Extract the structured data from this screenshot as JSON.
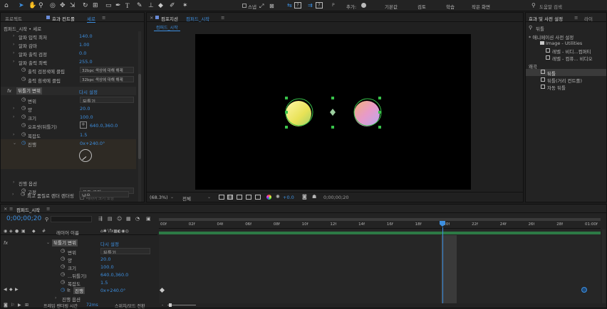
{
  "toolbar": {
    "snap_label": "스냅",
    "mode_icon_label": "P",
    "default_label": "기본값",
    "review_label": "검토",
    "learn_label": "학습",
    "small_screen_label": "작은 화면",
    "search_placeholder": "도움말 검색"
  },
  "left_panel": {
    "tab_project": "프로젝트",
    "tab_effects": "효과 컨트롤",
    "tab_effects_target": "세로",
    "breadcrumb": "컴퍼드_시작 • 세로",
    "rows": [
      {
        "label": "알파 입력 최저",
        "value": "140.0"
      },
      {
        "label": "알파 감마",
        "value": "1.00"
      },
      {
        "label": "알파 출력 검정",
        "value": "0.0"
      },
      {
        "label": "알파 출력 최백",
        "value": "255.0"
      }
    ],
    "clip_black_label": "출력 검정색에 클립",
    "clip_black_value": "32bpc 색상에 대해 해제",
    "clip_white_label": "출력 흰색에 클립",
    "clip_white_value": "32bpc 색상에 대해 해제",
    "fx_name": "뒤틀기 변위",
    "reset": "다시 설정",
    "props": [
      {
        "label": "변위",
        "value": "뒤틀기"
      },
      {
        "label": "양",
        "value": "20.0"
      },
      {
        "label": "크기",
        "value": "100.0"
      },
      {
        "label": "오프셋(뒤틀기)",
        "value": "640.0,360.0"
      },
      {
        "label": "복잡도",
        "value": "1.5"
      },
      {
        "label": "진행",
        "value": "0x+240.0°"
      }
    ],
    "phase_label": "진행 옵션",
    "pin_label": "고정",
    "pin_value": "모두 고정",
    "resize_label": "레이어 크기 조정",
    "quality_label": "최고 품질로 렌더 렌더링",
    "quality_value": "낮음"
  },
  "comp_panel": {
    "tab_comp": "컴포지션",
    "tab_name": "컴퍼드_시작",
    "sub_tab": "컴퍼드_시작",
    "zoom": "(68.3%)",
    "res": "전체",
    "exposure": "+0.0",
    "timecode": "0;00;00;20"
  },
  "right_panel": {
    "tab_effects": "효과 및 사전 설정",
    "tab_lib": "라이",
    "search": "뒤틀",
    "tree": [
      "* 애니메이션 사전 설정",
      "Image - Utilities",
      "레벨 - 비디...컴퍼티",
      "레벨 - 컴퓨... 비디오",
      "왜곡",
      "뒤틀",
      "뒤틀(거리 컨트롤)",
      "자동 뒤틀"
    ]
  },
  "timeline": {
    "tab": "컴퍼드_시작",
    "timecode": "0;00;00;20",
    "layer_header": "레이어 이름",
    "rulers": [
      "00f",
      "02f",
      "04f",
      "06f",
      "08f",
      "10f",
      "12f",
      "14f",
      "16f",
      "18f",
      "20f",
      "22f",
      "24f",
      "26f",
      "28f",
      "01:00f"
    ],
    "fx_name": "뒤틀기 변위",
    "reset": "다시 설정",
    "props": [
      {
        "label": "변위",
        "value": "뒤틀기"
      },
      {
        "label": "양",
        "value": "20.0"
      },
      {
        "label": "크기",
        "value": "100.0"
      },
      {
        "label": "...뒤틀기)",
        "value": "640.0,360.0"
      },
      {
        "label": "복잡도",
        "value": "1.5"
      },
      {
        "label": "진행",
        "value": "0x+240.0°"
      }
    ],
    "phase_label": "진행 옵션",
    "footer_render": "프레임 렌더링 시간",
    "footer_ms": "72ms",
    "footer_toggle": "스위치/모드 전환"
  }
}
